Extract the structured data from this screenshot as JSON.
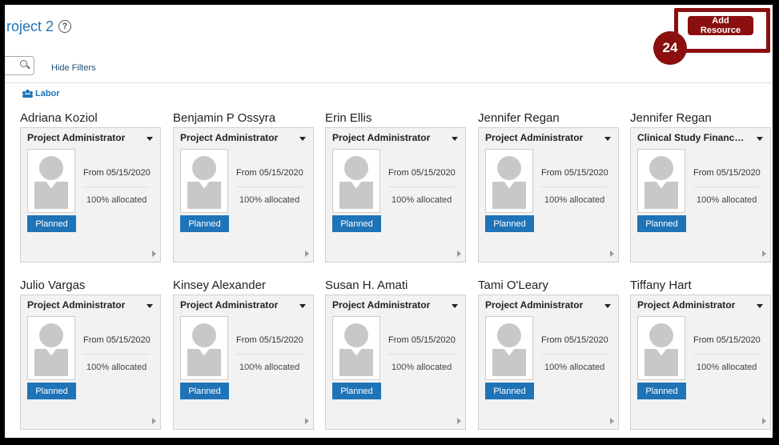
{
  "header": {
    "title": "roject 2",
    "help_icon": "?",
    "add_resource_label": "Add Resource",
    "step_number": "24"
  },
  "filters": {
    "hide_filters_label": "Hide Filters"
  },
  "section": {
    "labor_label": "Labor"
  },
  "colors": {
    "accent": "#1f73b7",
    "highlight": "#8b0f0f"
  },
  "resources": [
    {
      "name": "Adriana Koziol",
      "role": "Project Administrator",
      "from_label": "From",
      "from_date": "05/15/2020",
      "allocation": "100% allocated",
      "status": "Planned"
    },
    {
      "name": "Benjamin P Ossyra",
      "role": "Project Administrator",
      "from_label": "From",
      "from_date": "05/15/2020",
      "allocation": "100% allocated",
      "status": "Planned"
    },
    {
      "name": "Erin Ellis",
      "role": "Project Administrator",
      "from_label": "From",
      "from_date": "05/15/2020",
      "allocation": "100% allocated",
      "status": "Planned"
    },
    {
      "name": "Jennifer Regan",
      "role": "Project Administrator",
      "from_label": "From",
      "from_date": "05/15/2020",
      "allocation": "100% allocated",
      "status": "Planned"
    },
    {
      "name": "Jennifer Regan",
      "role": "Clinical Study Finance ...",
      "from_label": "From",
      "from_date": "05/15/2020",
      "allocation": "100% allocated",
      "status": "Planned"
    },
    {
      "name": "Julio Vargas",
      "role": "Project Administrator",
      "from_label": "From",
      "from_date": "05/15/2020",
      "allocation": "100% allocated",
      "status": "Planned"
    },
    {
      "name": "Kinsey Alexander",
      "role": "Project Administrator",
      "from_label": "From",
      "from_date": "05/15/2020",
      "allocation": "100% allocated",
      "status": "Planned"
    },
    {
      "name": "Susan H. Amati",
      "role": "Project Administrator",
      "from_label": "From",
      "from_date": "05/15/2020",
      "allocation": "100% allocated",
      "status": "Planned"
    },
    {
      "name": "Tami O'Leary",
      "role": "Project Administrator",
      "from_label": "From",
      "from_date": "05/15/2020",
      "allocation": "100% allocated",
      "status": "Planned"
    },
    {
      "name": "Tiffany Hart",
      "role": "Project Administrator",
      "from_label": "From",
      "from_date": "05/15/2020",
      "allocation": "100% allocated",
      "status": "Planned"
    }
  ]
}
